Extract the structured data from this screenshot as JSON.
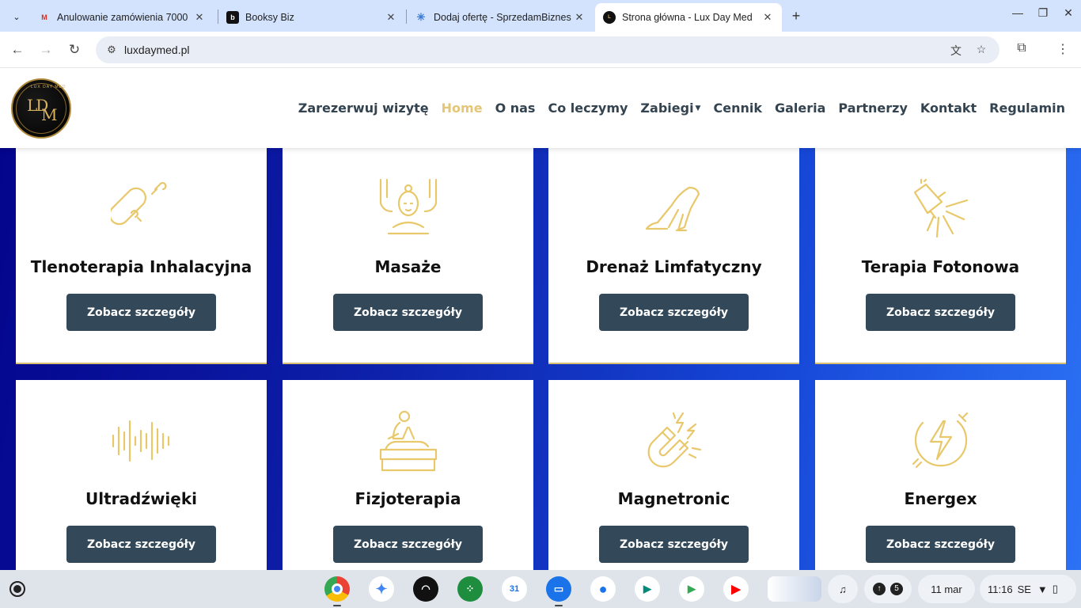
{
  "browser": {
    "tabs": [
      {
        "title": "Anulowanie zamówienia 7000",
        "favicon": "gmail-icon"
      },
      {
        "title": "Booksy Biz",
        "favicon": "booksy-icon"
      },
      {
        "title": "Dodaj ofertę - SprzedamBiznes",
        "favicon": "sprzedambiznes-icon"
      },
      {
        "title": "Strona główna - Lux Day Med",
        "favicon": "luxdaymed-icon"
      }
    ],
    "url": "luxdaymed.pl"
  },
  "site": {
    "logo_text": "LDM",
    "logo_arc": "LUX DAY MED",
    "nav": [
      {
        "label": "Zarezerwuj wizytę"
      },
      {
        "label": "Home",
        "active": true
      },
      {
        "label": "O nas"
      },
      {
        "label": "Co leczymy"
      },
      {
        "label": "Zabiegi",
        "dropdown": true
      },
      {
        "label": "Cennik"
      },
      {
        "label": "Galeria"
      },
      {
        "label": "Partnerzy"
      },
      {
        "label": "Kontakt"
      },
      {
        "label": "Regulamin"
      }
    ],
    "services": [
      {
        "title": "Tlenoterapia Inhalacyjna",
        "icon": "oxygen-tank-icon",
        "button": "Zobacz szczegóły"
      },
      {
        "title": "Masaże",
        "icon": "massage-icon",
        "button": "Zobacz szczegóły"
      },
      {
        "title": "Drenaż Limfatyczny",
        "icon": "legs-icon",
        "button": "Zobacz szczegóły"
      },
      {
        "title": "Terapia Fotonowa",
        "icon": "light-lamp-icon",
        "button": "Zobacz szczegóły"
      },
      {
        "title": "Ultradźwięki",
        "icon": "sound-wave-icon",
        "button": "Zobacz szczegóły"
      },
      {
        "title": "Fizjoterapia",
        "icon": "physiotherapy-icon",
        "button": "Zobacz szczegóły"
      },
      {
        "title": "Magnetronic",
        "icon": "magnet-icon",
        "button": "Zobacz szczegóły"
      },
      {
        "title": "Energex",
        "icon": "energy-bolt-icon",
        "button": "Zobacz szczegóły"
      }
    ],
    "colors": {
      "accent": "#e3c677",
      "button": "#33495a",
      "nav": "#334350"
    }
  },
  "shelf": {
    "date": "11 mar",
    "time": "11:16",
    "lang": "SE",
    "notifications": "5"
  }
}
